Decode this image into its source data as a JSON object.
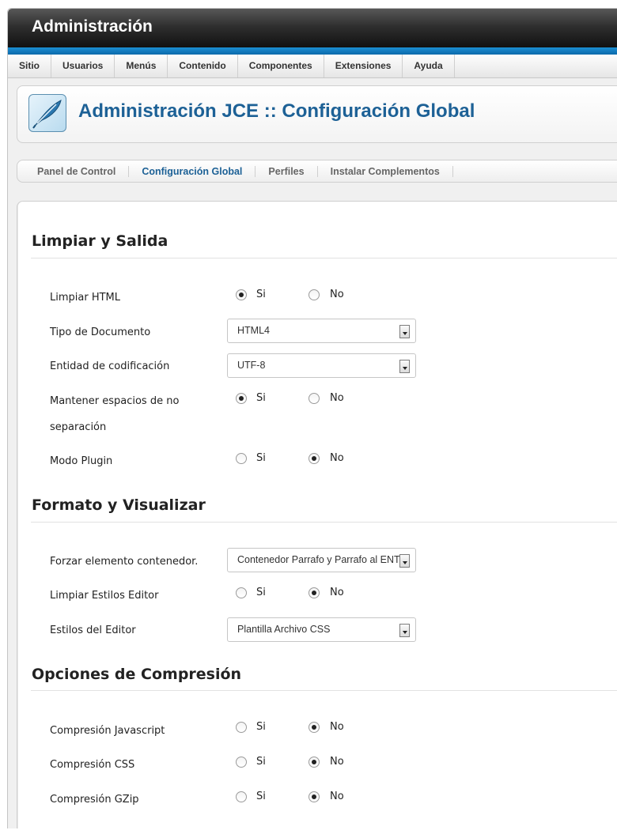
{
  "header": {
    "title": "Administración"
  },
  "menu": [
    "Sitio",
    "Usuarios",
    "Menús",
    "Contenido",
    "Componentes",
    "Extensiones",
    "Ayuda"
  ],
  "page_title": "Administración JCE :: Configuración Global",
  "tabs": [
    "Panel de Control",
    "Configuración Global",
    "Perfiles",
    "Instalar Complementos"
  ],
  "active_tab": "Configuración Global",
  "sections": {
    "limpiar": {
      "title": "Limpiar y Salida",
      "limpiar_html": {
        "label": "Limpiar HTML",
        "yes": "Si",
        "no": "No",
        "selected": "Si"
      },
      "tipo_documento": {
        "label": "Tipo de Documento",
        "value": "HTML4"
      },
      "entidad": {
        "label": "Entidad de codificación",
        "value": "UTF-8"
      },
      "espacios": {
        "label_line1": "Mantener espacios de no",
        "label_line2": "separación",
        "yes": "Si",
        "no": "No",
        "selected": "Si"
      },
      "modo_plugin": {
        "label": "Modo Plugin",
        "yes": "Si",
        "no": "No",
        "selected": "No"
      }
    },
    "formato": {
      "title": "Formato y Visualizar",
      "forzar": {
        "label": "Forzar elemento contenedor.",
        "value": "Contenedor Parrafo y Parrafo al ENTER"
      },
      "limpiar_estilos": {
        "label": "Limpiar Estilos Editor",
        "yes": "Si",
        "no": "No",
        "selected": "No"
      },
      "estilos_editor": {
        "label": "Estilos del Editor",
        "value": "Plantilla Archivo CSS"
      }
    },
    "compresion": {
      "title": "Opciones de Compresión",
      "javascript": {
        "label": "Compresión Javascript",
        "yes": "Si",
        "no": "No",
        "selected": "No"
      },
      "css": {
        "label": "Compresión CSS",
        "yes": "Si",
        "no": "No",
        "selected": "No"
      },
      "gzip": {
        "label": "Compresión GZip",
        "yes": "Si",
        "no": "No",
        "selected": "No"
      }
    }
  },
  "icons": {
    "logo": "jce-feather-logo-icon",
    "select_arrow": "chevron-down-icon"
  },
  "colors": {
    "accent": "#1d6196",
    "header_stripe": "#0c6aab"
  }
}
